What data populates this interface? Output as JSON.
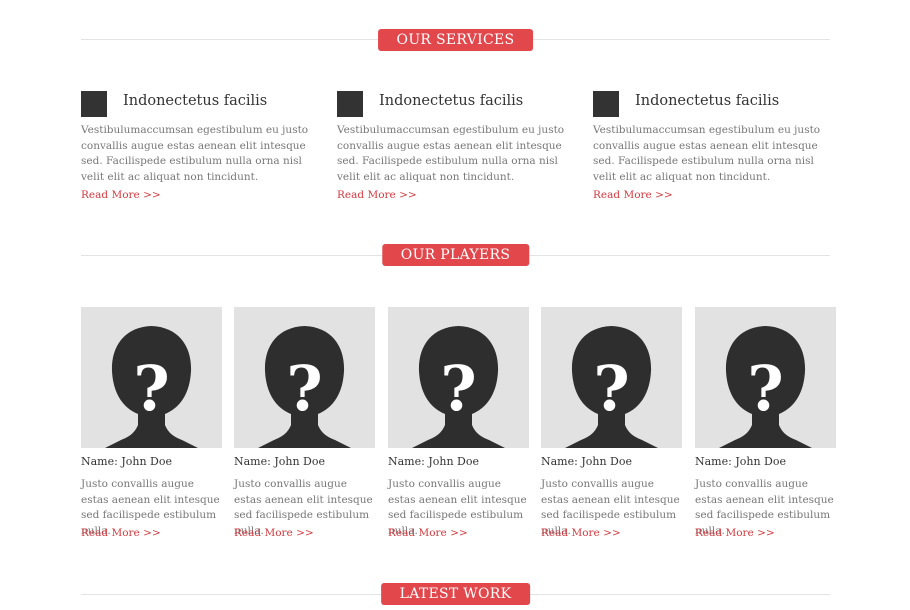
{
  "sections": {
    "services_title": "OUR SERVICES",
    "players_title": "OUR PLAYERS",
    "latest_title": "LATEST WORK"
  },
  "services": [
    {
      "icon": "square-icon",
      "title": "Indonectetus facilis",
      "description": "Vestibulumaccumsan egestibulum eu justo convallis augue estas aenean elit intesque sed. Facilispede estibulum nulla orna nisl velit elit ac aliquat non tincidunt.",
      "read_more": "Read More >>"
    },
    {
      "icon": "square-icon",
      "title": "Indonectetus facilis",
      "description": "Vestibulumaccumsan egestibulum eu justo convallis augue estas aenean elit intesque sed. Facilispede estibulum nulla orna nisl velit elit ac aliquat non tincidunt.",
      "read_more": "Read More >>"
    },
    {
      "icon": "square-icon",
      "title": "Indonectetus facilis",
      "description": "Vestibulumaccumsan egestibulum eu justo convallis augue estas aenean elit intesque sed. Facilispede estibulum nulla orna nisl velit elit ac aliquat non tincidunt.",
      "read_more": "Read More >>"
    }
  ],
  "players": [
    {
      "name": "Name: John Doe",
      "description": "Justo convallis augue estas aenean elit intesque sed facilispede estibulum nulla.",
      "read_more": "Read More >>"
    },
    {
      "name": "Name: John Doe",
      "description": "Justo convallis augue estas aenean elit intesque sed facilispede estibulum nulla.",
      "read_more": "Read More >>"
    },
    {
      "name": "Name: John Doe",
      "description": "Justo convallis augue estas aenean elit intesque sed facilispede estibulum nulla.",
      "read_more": "Read More >>"
    },
    {
      "name": "Name: John Doe",
      "description": "Justo convallis augue estas aenean elit intesque sed facilispede estibulum nulla.",
      "read_more": "Read More >>"
    },
    {
      "name": "Name: John Doe",
      "description": "Justo convallis augue estas aenean elit intesque sed facilispede estibulum nulla.",
      "read_more": "Read More >>"
    }
  ],
  "colors": {
    "accent": "#e2474c",
    "link": "#d63a40",
    "icon_dark": "#333333",
    "photo_bg": "#e2e2e2"
  }
}
